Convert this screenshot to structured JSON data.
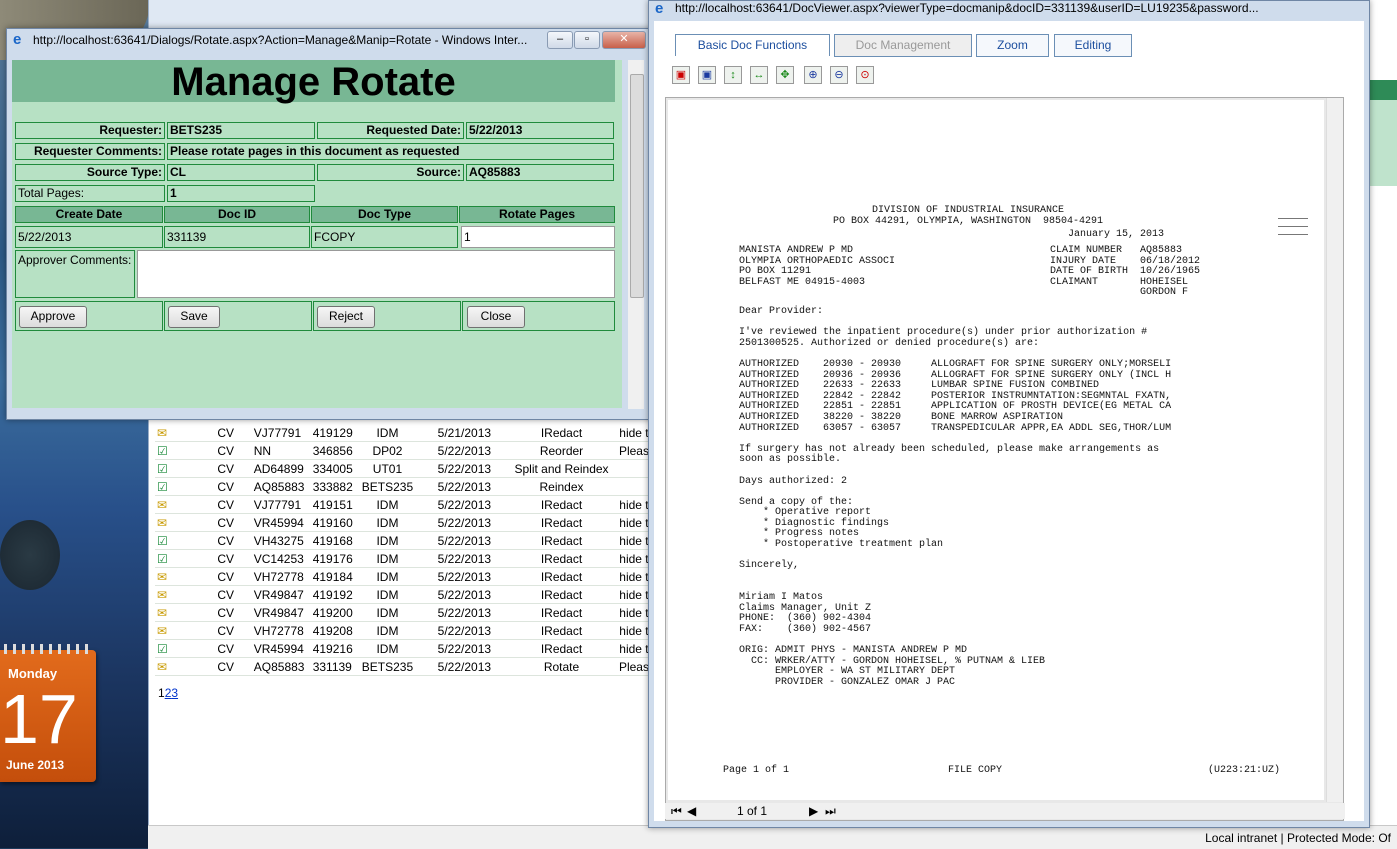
{
  "main_grid": {
    "rows": [
      {
        "icon": "mail",
        "type": "CV",
        "claim": "VJ77791",
        "doc_id": "419129",
        "doc_type": "IDM",
        "date": "5/21/2013",
        "action": "IRedact",
        "extra": "hide t"
      },
      {
        "icon": "check",
        "type": "CV",
        "claim": "NN",
        "doc_id": "346856",
        "doc_type": "DP02",
        "date": "5/22/2013",
        "action": "Reorder",
        "extra": "Pleas"
      },
      {
        "icon": "check",
        "type": "CV",
        "claim": "AD64899",
        "doc_id": "334005",
        "doc_type": "UT01",
        "date": "5/22/2013",
        "action": "Split and Reindex",
        "extra": ""
      },
      {
        "icon": "check",
        "type": "CV",
        "claim": "AQ85883",
        "doc_id": "333882",
        "doc_type": "BETS235",
        "date": "5/22/2013",
        "action": "Reindex",
        "extra": ""
      },
      {
        "icon": "mail",
        "type": "CV",
        "claim": "VJ77791",
        "doc_id": "419151",
        "doc_type": "IDM",
        "date": "5/22/2013",
        "action": "IRedact",
        "extra": "hide t"
      },
      {
        "icon": "mail",
        "type": "CV",
        "claim": "VR45994",
        "doc_id": "419160",
        "doc_type": "IDM",
        "date": "5/22/2013",
        "action": "IRedact",
        "extra": "hide t"
      },
      {
        "icon": "check",
        "type": "CV",
        "claim": "VH43275",
        "doc_id": "419168",
        "doc_type": "IDM",
        "date": "5/22/2013",
        "action": "IRedact",
        "extra": "hide t"
      },
      {
        "icon": "check",
        "type": "CV",
        "claim": "VC14253",
        "doc_id": "419176",
        "doc_type": "IDM",
        "date": "5/22/2013",
        "action": "IRedact",
        "extra": "hide t"
      },
      {
        "icon": "mail",
        "type": "CV",
        "claim": "VH72778",
        "doc_id": "419184",
        "doc_type": "IDM",
        "date": "5/22/2013",
        "action": "IRedact",
        "extra": "hide t"
      },
      {
        "icon": "mail",
        "type": "CV",
        "claim": "VR49847",
        "doc_id": "419192",
        "doc_type": "IDM",
        "date": "5/22/2013",
        "action": "IRedact",
        "extra": "hide t"
      },
      {
        "icon": "mail",
        "type": "CV",
        "claim": "VR49847",
        "doc_id": "419200",
        "doc_type": "IDM",
        "date": "5/22/2013",
        "action": "IRedact",
        "extra": "hide t"
      },
      {
        "icon": "mail",
        "type": "CV",
        "claim": "VH72778",
        "doc_id": "419208",
        "doc_type": "IDM",
        "date": "5/22/2013",
        "action": "IRedact",
        "extra": "hide t"
      },
      {
        "icon": "check",
        "type": "CV",
        "claim": "VR45994",
        "doc_id": "419216",
        "doc_type": "IDM",
        "date": "5/22/2013",
        "action": "IRedact",
        "extra": "hide t"
      },
      {
        "icon": "mail",
        "type": "CV",
        "claim": "AQ85883",
        "doc_id": "331139",
        "doc_type": "BETS235",
        "date": "5/22/2013",
        "action": "Rotate",
        "extra": "Pleas"
      }
    ],
    "pager": {
      "current": "1",
      "p2": "2",
      "p3": "3"
    }
  },
  "calendar": {
    "weekday": "Monday",
    "day": "17",
    "month_year": "June 2013"
  },
  "statusbar": {
    "text": "Local intranet | Protected Mode: Of"
  },
  "rotate_dialog": {
    "window_title": "http://localhost:63641/Dialogs/Rotate.aspx?Action=Manage&Manip=Rotate - Windows Inter...",
    "heading": "Manage Rotate",
    "requester_label": "Requester:",
    "requester": "BETS235",
    "requested_date_label": "Requested Date:",
    "requested_date": "5/22/2013",
    "requester_comments_label": "Requester Comments:",
    "requester_comments": "Please rotate pages in this document as requested",
    "source_type_label": "Source Type:",
    "source_type": "CL",
    "source_label": "Source:",
    "source": "AQ85883",
    "total_pages_label": "Total Pages:",
    "total_pages": "1",
    "columns": [
      "Create Date",
      "Doc ID",
      "Doc Type",
      "Rotate Pages"
    ],
    "row": {
      "create_date": "5/22/2013",
      "doc_id": "331139",
      "doc_type": "FCOPY",
      "rotate_pages": "1"
    },
    "approver_comments_label": "Approver Comments:",
    "buttons": {
      "approve": "Approve",
      "save": "Save",
      "reject": "Reject",
      "close": "Close"
    }
  },
  "doc_viewer": {
    "window_title": "http://localhost:63641/DocViewer.aspx?viewerType=docmanip&docID=331139&userID=LU19235&password...",
    "tabs": [
      "Basic Doc Functions",
      "Doc Management",
      "Zoom",
      "Editing"
    ],
    "toolbar_icons": [
      "rotate-left-icon",
      "rotate-right-icon",
      "flip-vertical-icon",
      "flip-horizontal-icon",
      "pan-icon",
      "zoom-in-icon",
      "zoom-out-icon",
      "zoom-fit-icon"
    ],
    "nav": {
      "page_indicator": "1 of 1"
    },
    "document": {
      "header": "DIVISION OF INDUSTRIAL INSURANCE\nPO BOX 44291, OLYMPIA, WASHINGTON  98504-4291",
      "date": "January 15, 2013",
      "address": "MANISTA ANDREW P MD\nOLYMPIA ORTHOPAEDIC ASSOCI\nPO BOX 11291\nBELFAST ME 04915-4003",
      "claim_info": "CLAIM NUMBER   AQ85883\nINJURY DATE    06/18/2012\nDATE OF BIRTH  10/26/1965\nCLAIMANT       HOHEISEL\n               GORDON F",
      "body": "Dear Provider:\n\nI've reviewed the inpatient procedure(s) under prior authorization #\n2501300525. Authorized or denied procedure(s) are:\n\nAUTHORIZED    20930 - 20930     ALLOGRAFT FOR SPINE SURGERY ONLY;MORSELI\nAUTHORIZED    20936 - 20936     ALLOGRAFT FOR SPINE SURGERY ONLY (INCL H\nAUTHORIZED    22633 - 22633     LUMBAR SPINE FUSION COMBINED\nAUTHORIZED    22842 - 22842     POSTERIOR INSTRUMNTATION:SEGMNTAL FXATN,\nAUTHORIZED    22851 - 22851     APPLICATION OF PROSTH DEVICE(EG METAL CA\nAUTHORIZED    38220 - 38220     BONE MARROW ASPIRATION\nAUTHORIZED    63057 - 63057     TRANSPEDICULAR APPR,EA ADDL SEG,THOR/LUM\n\nIf surgery has not already been scheduled, please make arrangements as\nsoon as possible.\n\nDays authorized: 2\n\nSend a copy of the:\n    * Operative report\n    * Diagnostic findings\n    * Progress notes\n    * Postoperative treatment plan\n\nSincerely,\n\n\nMiriam I Matos\nClaims Manager, Unit Z\nPHONE:  (360) 902-4304\nFAX:    (360) 902-4567\n\nORIG: ADMIT PHYS - MANISTA ANDREW P MD\n  CC: WRKER/ATTY - GORDON HOHEISEL, % PUTNAM & LIEB\n      EMPLOYER - WA ST MILITARY DEPT\n      PROVIDER - GONZALEZ OMAR J PAC",
      "footer_left": "Page 1 of 1",
      "footer_mid": "FILE COPY",
      "footer_right": "(U223:21:UZ)"
    }
  },
  "colors": {
    "form_bg": "#b7e1c4",
    "header_bg": "#78b794",
    "border": "#1f8a3c",
    "tab_text": "#1c4e9e"
  }
}
